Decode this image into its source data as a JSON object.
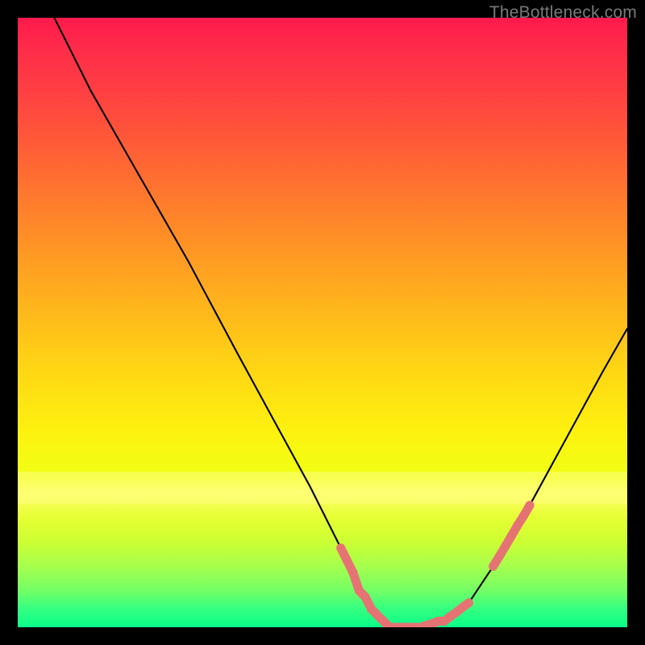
{
  "watermark": "TheBottleneck.com",
  "colors": {
    "bg": "#000000",
    "watermark_text": "#7a7a7a",
    "curve": "#000000",
    "marker": "#e67373"
  },
  "chart_data": {
    "type": "line",
    "title": "",
    "xlabel": "",
    "ylabel": "",
    "xlim": [
      0,
      100
    ],
    "ylim": [
      0,
      100
    ],
    "series": [
      {
        "name": "bottleneck-curve",
        "x": [
          6,
          12,
          20,
          28,
          36,
          42,
          48,
          53,
          56,
          59,
          62,
          66,
          70,
          74,
          78,
          84,
          90,
          96,
          100
        ],
        "y": [
          100,
          88,
          74,
          60,
          45,
          34,
          23,
          13,
          6,
          2,
          0,
          0,
          1,
          4,
          10,
          20,
          31,
          42,
          49
        ]
      }
    ],
    "markers": {
      "name": "highlighted-range",
      "segments": [
        {
          "x": [
            53,
            54,
            55,
            56,
            57,
            58,
            59,
            60,
            61,
            62,
            63,
            64,
            65,
            66,
            67,
            68,
            69,
            70,
            71,
            72,
            73,
            74
          ],
          "y": [
            13,
            11,
            9,
            6,
            5,
            3,
            2,
            1,
            0,
            0,
            0,
            0,
            0,
            0,
            0.3,
            0.6,
            1,
            1,
            1.8,
            2.5,
            3.3,
            4
          ]
        },
        {
          "x": [
            78,
            79,
            80,
            81,
            82,
            83,
            84
          ],
          "y": [
            10,
            11.6,
            13.3,
            15,
            16.7,
            18.3,
            20
          ]
        }
      ]
    },
    "gradient_stops": [
      {
        "pos": 0,
        "color": "#ff1a4d"
      },
      {
        "pos": 50,
        "color": "#ffcc14"
      },
      {
        "pos": 78,
        "color": "#ffff80"
      },
      {
        "pos": 100,
        "color": "#0aff8a"
      }
    ]
  }
}
